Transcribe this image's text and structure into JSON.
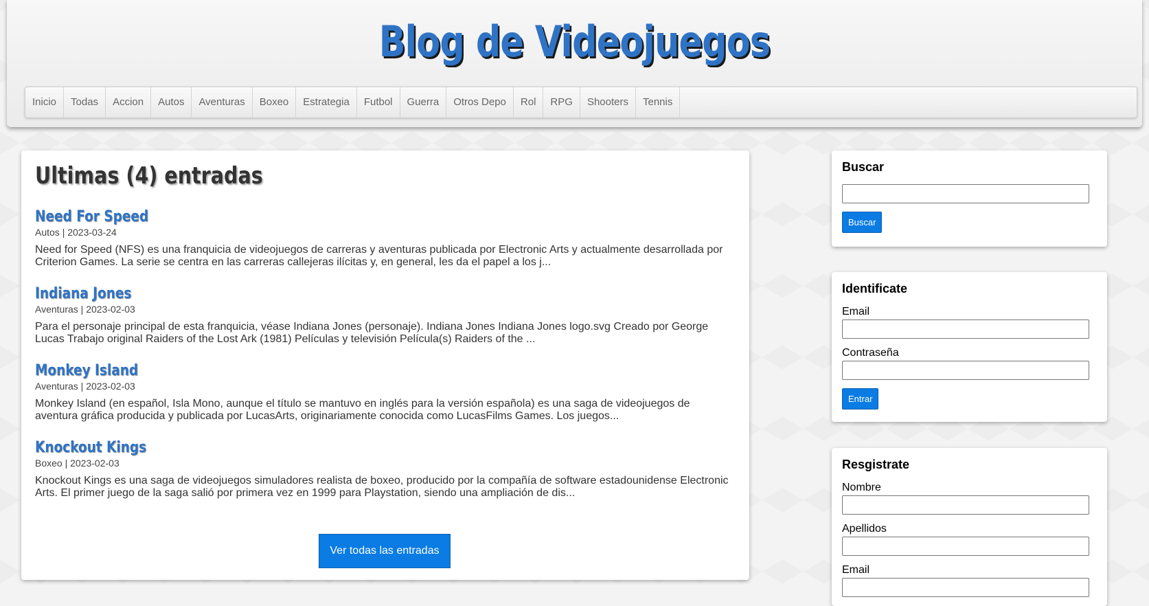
{
  "header": {
    "title": "Blog de Videojuegos",
    "nav": [
      "Inicio",
      "Todas",
      "Accion",
      "Autos",
      "Aventuras",
      "Boxeo",
      "Estrategia",
      "Futbol",
      "Guerra",
      "Otros Depo",
      "Rol",
      "RPG",
      "Shooters",
      "Tennis"
    ]
  },
  "main": {
    "heading": "Ultimas (4) entradas",
    "posts": [
      {
        "title": "Need For Speed",
        "meta": "Autos | 2023-03-24",
        "excerpt": "Need for Speed (NFS) es una franquicia de videojuegos de carreras y aventuras publicada por Electronic Arts y actualmente desarrollada por Criterion Games. La serie se centra en las carreras callejeras ilícitas y, en general, les da el papel a los j..."
      },
      {
        "title": "Indiana Jones",
        "meta": "Aventuras | 2023-02-03",
        "excerpt": "Para el personaje principal de esta franquicia, véase Indiana Jones (personaje). Indiana Jones Indiana Jones logo.svg Creado por George Lucas Trabajo original Raiders of the Lost Ark (1981) Películas y televisión Película(s) Raiders of the ..."
      },
      {
        "title": "Monkey Island",
        "meta": "Aventuras | 2023-02-03",
        "excerpt": "Monkey Island (en español, Isla Mono, aunque el título se mantuvo en inglés para la versión española) es una saga de videojuegos de aventura gráfica producida y publicada por LucasArts, originariamente conocida como LucasFilms Games. Los juegos..."
      },
      {
        "title": "Knockout Kings",
        "meta": "Boxeo | 2023-02-03",
        "excerpt": "Knockout Kings es una saga de videojuegos simuladores realista de boxeo, producido por la compañía de software estadounidense Electronic Arts. El primer juego de la saga salió por primera vez en 1999 para Playstation, siendo una ampliación de dis..."
      }
    ],
    "all_button": "Ver todas las entradas"
  },
  "sidebar": {
    "search": {
      "title": "Buscar",
      "button": "Buscar"
    },
    "login": {
      "title": "Identificate",
      "email_label": "Email",
      "password_label": "Contraseña",
      "button": "Entrar"
    },
    "register": {
      "title": "Resgistrate",
      "name_label": "Nombre",
      "surname_label": "Apellidos",
      "email_label": "Email"
    }
  }
}
